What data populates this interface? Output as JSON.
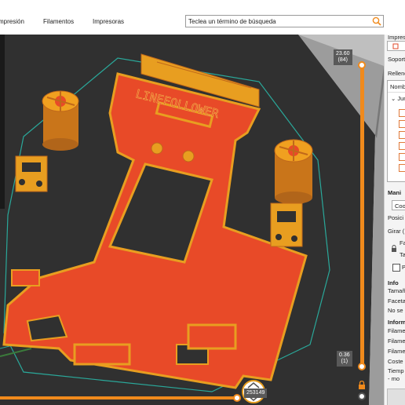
{
  "menu": {
    "items": [
      {
        "label": "mpresión"
      },
      {
        "label": "Filamentos"
      },
      {
        "label": "Impresoras"
      }
    ]
  },
  "search": {
    "placeholder": "Teclea un término de búsqueda"
  },
  "bed": {
    "text": "LINEFOLLOWER"
  },
  "vertical_slider": {
    "top_value": "23.60",
    "top_layer": "(84)",
    "bottom_value": "0.36",
    "bottom_layer": "(1)",
    "top_fraction": 1.0,
    "bottom_fraction": 0.0
  },
  "horizontal_slider": {
    "value": "253149",
    "fraction": 1.0
  },
  "sidepanel": {
    "print_label": "Impreso",
    "support_label": "Soporte",
    "infill_label": "Relleno",
    "name_label": "Nombr",
    "junk_label": "Jun",
    "manip_label": "Mani",
    "coord_label": "Coo",
    "pos_label": "Posici",
    "rotate_label": "Girar (",
    "scale_a": "Fa",
    "scale_b": "Ta",
    "uniform_label": "P",
    "info_label": "Info",
    "size_label": "Tamañ",
    "facets_label": "Faceta",
    "no_label": "No se",
    "inform_label": "Inform",
    "fil1": "Filame",
    "fil2": "Filame",
    "fil3": "Filame",
    "cost": "Coste",
    "time": "Tiemp",
    "time_sub": "- mo"
  },
  "colors": {
    "accent": "#f08a1c",
    "model_orange": "#e69a1c",
    "model_red": "#e04a2a",
    "bed_dark": "#333333"
  }
}
